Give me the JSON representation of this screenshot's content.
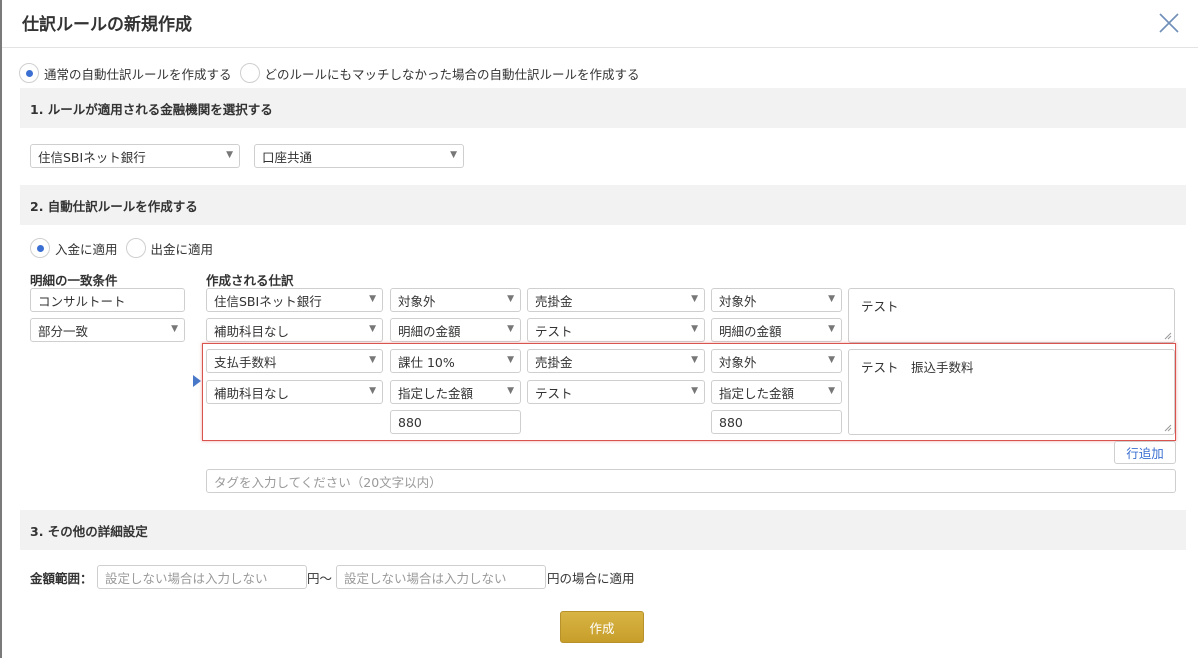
{
  "dialog": {
    "title": "仕訳ルールの新規作成",
    "close_icon": "close-icon"
  },
  "rule_type": {
    "options": [
      "通常の自動仕訳ルールを作成する",
      "どのルールにもマッチしなかった場合の自動仕訳ルールを作成する"
    ],
    "selected_index": 0
  },
  "section1": {
    "title": "1. ルールが適用される金融機関を選択する",
    "bank": "住信SBIネット銀行",
    "account": "口座共通"
  },
  "section2": {
    "title": "2. 自動仕訳ルールを作成する",
    "direction": {
      "options": [
        "入金に適用",
        "出金に適用"
      ],
      "selected_index": 0
    },
    "match_label": "明細の一致条件",
    "match_text": "コンサルトート",
    "match_type": "部分一致",
    "journal_label": "作成される仕訳",
    "rows": [
      {
        "debit_account": "住信SBIネット銀行",
        "debit_tax": "対象外",
        "credit_account": "売掛金",
        "credit_tax": "対象外",
        "debit_sub": "補助科目なし",
        "debit_amount_type": "明細の金額",
        "credit_sub": "テスト",
        "credit_amount_type": "明細の金額",
        "memo": "テスト"
      },
      {
        "debit_account": "支払手数料",
        "debit_tax": "課仕 10%",
        "credit_account": "売掛金",
        "credit_tax": "対象外",
        "debit_sub": "補助科目なし",
        "debit_amount_type": "指定した金額",
        "credit_sub": "テスト",
        "credit_amount_type": "指定した金額",
        "debit_amount": "880",
        "credit_amount": "880",
        "memo": "テスト　振込手数料"
      }
    ],
    "add_row_label": "行追加",
    "tag_placeholder": "タグを入力してください（20文字以内）"
  },
  "section3": {
    "title": "3. その他の詳細設定",
    "amount_range_label": "金額範囲：",
    "min_placeholder": "設定しない場合は入力しない",
    "between_text": "円〜",
    "max_placeholder": "設定しない場合は入力しない",
    "suffix_text": "円の場合に適用"
  },
  "submit_label": "作成",
  "colors": {
    "accent": "#3b6fd1",
    "submit": "#c9a232",
    "highlight": "#d9534f"
  }
}
